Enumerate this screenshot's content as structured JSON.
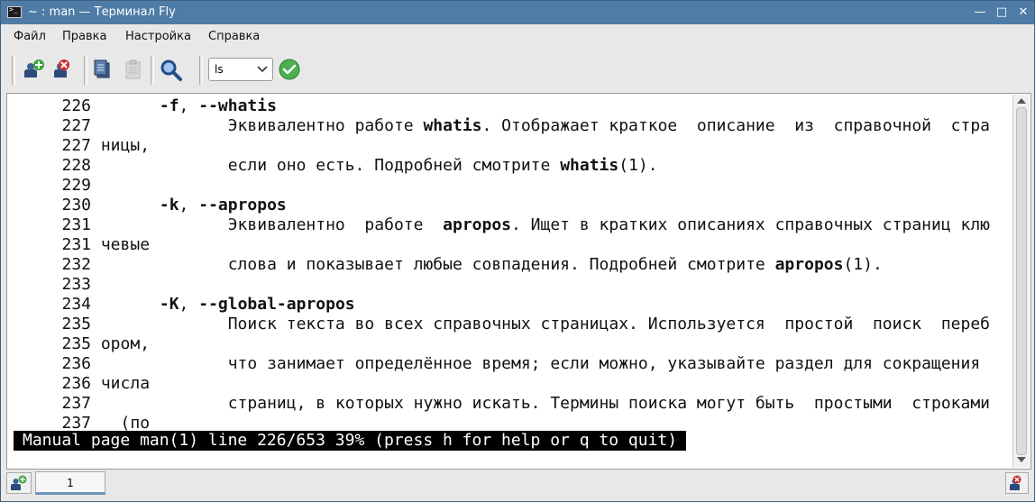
{
  "window": {
    "title": "~ : man — Терминал Fly",
    "controls": [
      "minimize",
      "maximize",
      "close"
    ]
  },
  "menu": [
    {
      "label": "Файл"
    },
    {
      "label": "Правка"
    },
    {
      "label": "Настройка"
    },
    {
      "label": "Справка"
    }
  ],
  "toolbar": {
    "command_value": "ls",
    "icons": [
      "new-tab-icon",
      "close-tab-icon",
      "copy-icon",
      "paste-icon",
      "search-icon",
      "run-command-icon"
    ]
  },
  "terminal": {
    "lines": [
      {
        "num": "226",
        "indent": "       ",
        "segments": [
          {
            "t": "-f",
            "b": true
          },
          {
            "t": ", ",
            "b": false
          },
          {
            "t": "--whatis",
            "b": true
          }
        ]
      },
      {
        "num": "227",
        "indent": "              ",
        "segments": [
          {
            "t": "Эквивалентно работе ",
            "b": false
          },
          {
            "t": "whatis",
            "b": true
          },
          {
            "t": ". Отображает краткое  описание  из  справочной  стра",
            "b": false
          }
        ]
      },
      {
        "num": "227",
        "indent": " ",
        "segments": [
          {
            "t": "ницы,",
            "b": false
          }
        ]
      },
      {
        "num": "228",
        "indent": "              ",
        "segments": [
          {
            "t": "если оно есть. Подробней смотрите ",
            "b": false
          },
          {
            "t": "whatis",
            "b": true
          },
          {
            "t": "(1).",
            "b": false
          }
        ]
      },
      {
        "num": "229",
        "indent": "",
        "segments": []
      },
      {
        "num": "230",
        "indent": "       ",
        "segments": [
          {
            "t": "-k",
            "b": true
          },
          {
            "t": ", ",
            "b": false
          },
          {
            "t": "--apropos",
            "b": true
          }
        ]
      },
      {
        "num": "231",
        "indent": "              ",
        "segments": [
          {
            "t": "Эквивалентно  работе  ",
            "b": false
          },
          {
            "t": "apropos",
            "b": true
          },
          {
            "t": ". Ищет в кратких описаниях справочных страниц клю",
            "b": false
          }
        ]
      },
      {
        "num": "231",
        "indent": " ",
        "segments": [
          {
            "t": "чевые",
            "b": false
          }
        ]
      },
      {
        "num": "232",
        "indent": "              ",
        "segments": [
          {
            "t": "слова и показывает любые совпадения. Подробней смотрите ",
            "b": false
          },
          {
            "t": "apropos",
            "b": true
          },
          {
            "t": "(1).",
            "b": false
          }
        ]
      },
      {
        "num": "233",
        "indent": "",
        "segments": []
      },
      {
        "num": "234",
        "indent": "       ",
        "segments": [
          {
            "t": "-K",
            "b": true
          },
          {
            "t": ", ",
            "b": false
          },
          {
            "t": "--global-apropos",
            "b": true
          }
        ]
      },
      {
        "num": "235",
        "indent": "              ",
        "segments": [
          {
            "t": "Поиск текста во всех справочных страницах. Используется  простой  поиск  переб",
            "b": false
          }
        ]
      },
      {
        "num": "235",
        "indent": " ",
        "segments": [
          {
            "t": "ором,",
            "b": false
          }
        ]
      },
      {
        "num": "236",
        "indent": "              ",
        "segments": [
          {
            "t": "что занимает определённое время; если можно, указывайте раздел для сокращения",
            "b": false
          }
        ]
      },
      {
        "num": "236",
        "indent": " ",
        "segments": [
          {
            "t": "числа",
            "b": false
          }
        ]
      },
      {
        "num": "237",
        "indent": "              ",
        "segments": [
          {
            "t": "страниц, в которых нужно искать. Термины поиска могут быть  простыми  строками",
            "b": false
          }
        ]
      },
      {
        "num": "237",
        "indent": "   ",
        "segments": [
          {
            "t": "(по",
            "b": false
          }
        ]
      }
    ],
    "status": "Manual page man(1) line 226/653 39% (press h for help or q to quit)"
  },
  "tabs": [
    {
      "label": "1",
      "active": true
    }
  ],
  "colors": {
    "titlebar": "#4f7ca6",
    "status_bg": "#000000",
    "run_green": "#4caf50"
  }
}
